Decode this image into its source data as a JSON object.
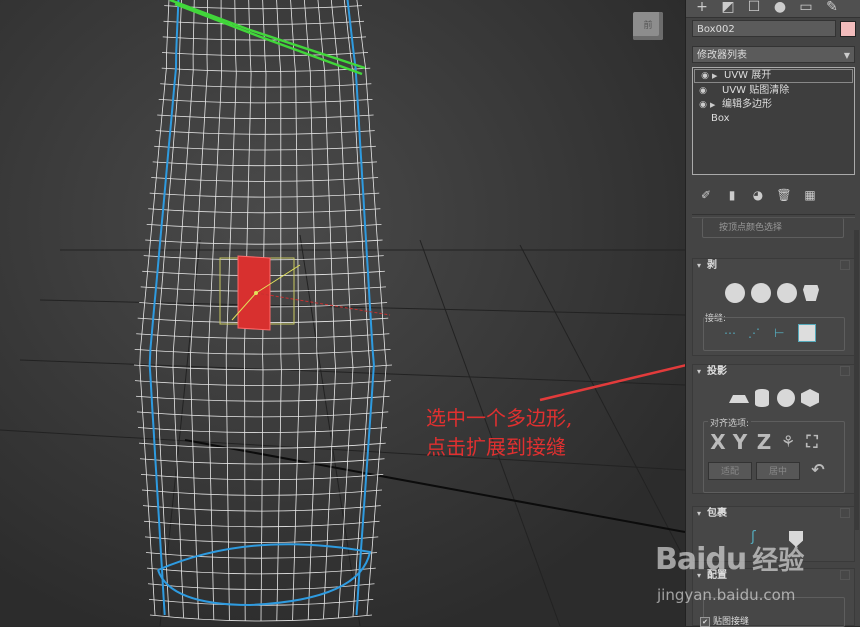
{
  "viewport": {
    "viewcube_label": "前",
    "annotation": {
      "line1": "选中一个多边形,",
      "line2": "点击扩展到接缝"
    }
  },
  "panel": {
    "tabs": [
      "create-icon",
      "modify-icon",
      "hierarchy-icon",
      "motion-icon",
      "display-icon",
      "utilities-icon"
    ],
    "object_name": "Box002",
    "object_color": "#f2bcbc",
    "modifier_list_label": "修改器列表",
    "stack": [
      {
        "label": "UVW 展开",
        "eye": true,
        "expand": true,
        "selected": true
      },
      {
        "label": "UVW 贴图清除",
        "eye": true,
        "expand": false,
        "selected": false
      },
      {
        "label": "编辑多边形",
        "eye": true,
        "expand": true,
        "selected": false
      },
      {
        "label": "Box",
        "eye": false,
        "expand": false,
        "selected": false
      }
    ],
    "partial_top_label": "按顶点颜色选择",
    "rollout_peel": {
      "title": "剥",
      "seams_label": "接缝:"
    },
    "rollout_projection": {
      "title": "投影",
      "align_label": "对齐选项:",
      "axes": [
        "X",
        "Y",
        "Z"
      ],
      "fit_button": "适配",
      "center_button": "居中"
    },
    "rollout_wrap": {
      "title": "包裹"
    },
    "rollout_config": {
      "title": "配置",
      "checkbox_label": "贴图接缝"
    }
  },
  "watermark": {
    "brand": "Baidu",
    "cn": "经验",
    "url": "jingyan.baidu.com"
  },
  "colors": {
    "viewport_bg": "#3a3a3a",
    "wire": "#ffffff",
    "seam_blue": "#2e9be0",
    "seam_green": "#41d63a",
    "selection_red": "#e0302f",
    "arrow_red": "#e23b3b"
  }
}
